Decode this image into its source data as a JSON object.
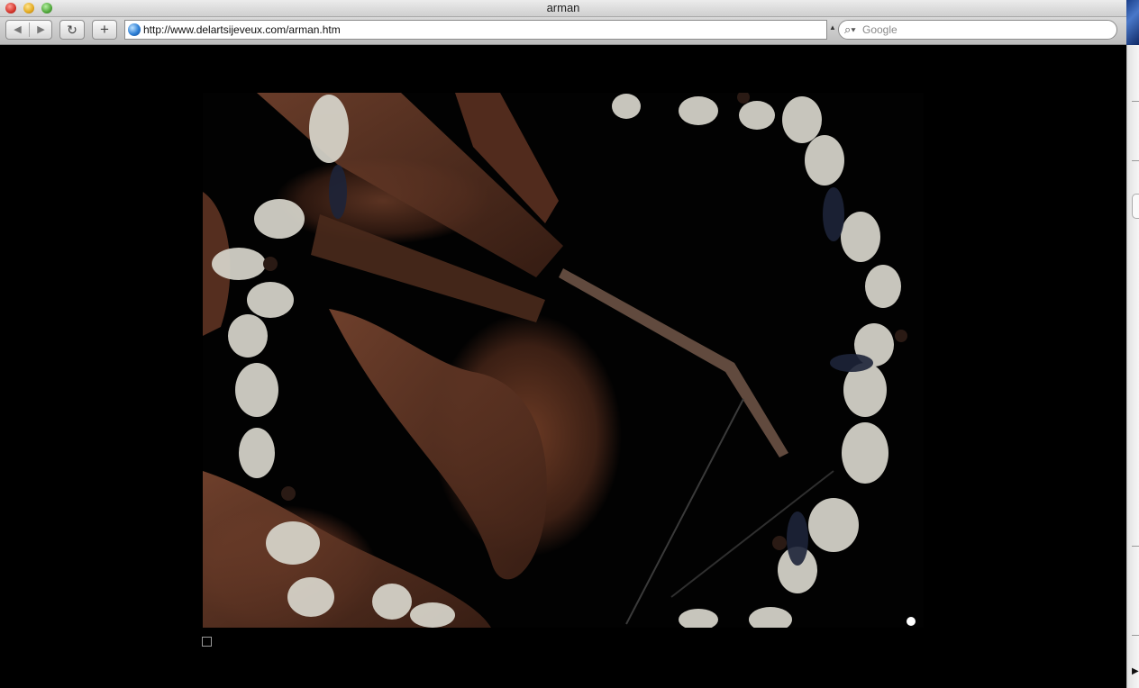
{
  "window": {
    "title": "arman"
  },
  "toolbar": {
    "url": "http://www.delartsijeveux.com/arman.htm",
    "search_placeholder": "Google",
    "reload_glyph": "↻",
    "add_glyph": "+",
    "back_glyph": "◀",
    "forward_glyph": "▶"
  },
  "icons": {
    "globe": "globe-icon",
    "search": "search-icon",
    "reload": "reload-icon",
    "add": "add-bookmark-icon"
  },
  "colors": {
    "page_background": "#000000",
    "artwork_wood": "#6b3a24",
    "figures": "#d8d6cc"
  }
}
